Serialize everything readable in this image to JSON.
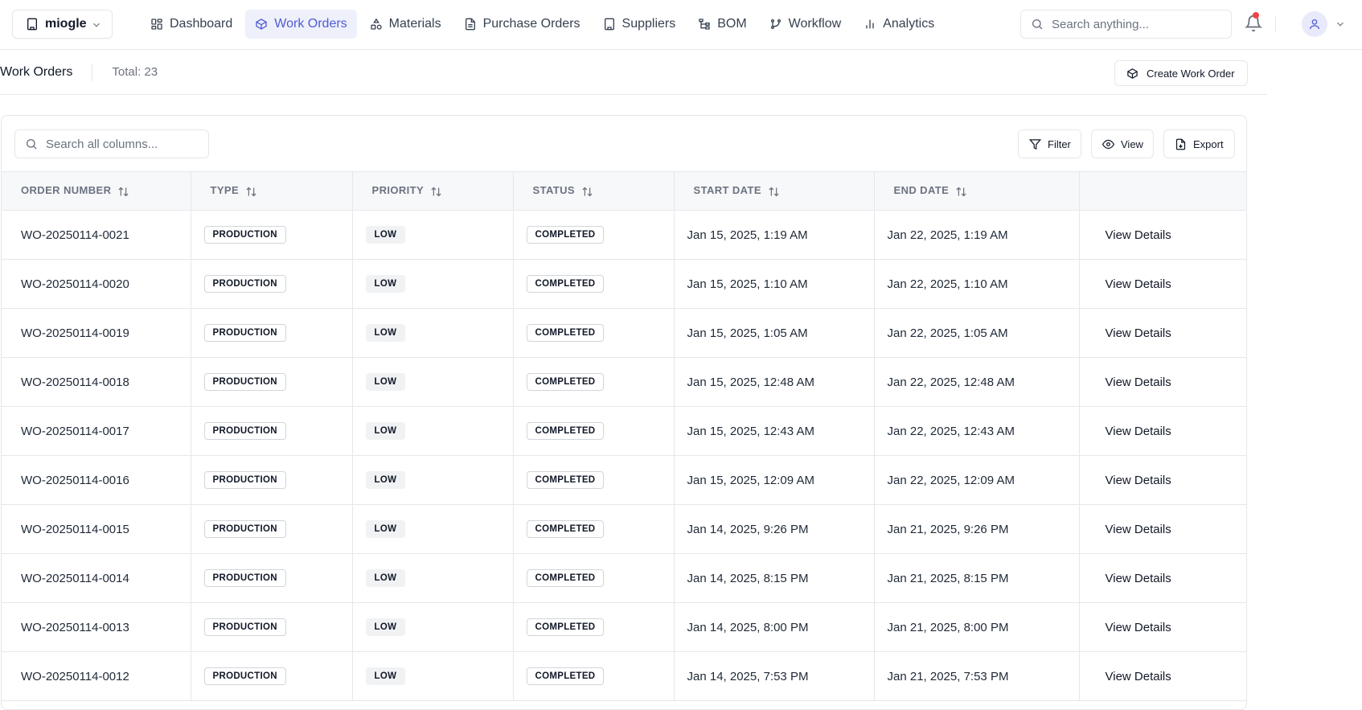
{
  "org": {
    "name": "miogle"
  },
  "nav": [
    {
      "label": "Dashboard",
      "icon": "dashboard-icon",
      "active": false
    },
    {
      "label": "Work Orders",
      "icon": "box-icon",
      "active": true
    },
    {
      "label": "Materials",
      "icon": "shapes-icon",
      "active": false
    },
    {
      "label": "Purchase Orders",
      "icon": "document-icon",
      "active": false
    },
    {
      "label": "Suppliers",
      "icon": "building-icon",
      "active": false
    },
    {
      "label": "BOM",
      "icon": "tree-icon",
      "active": false
    },
    {
      "label": "Workflow",
      "icon": "branch-icon",
      "active": false
    },
    {
      "label": "Analytics",
      "icon": "bar-chart-icon",
      "active": false
    }
  ],
  "search": {
    "placeholder": "Search anything..."
  },
  "subheader": {
    "title": "Work Orders",
    "total": "Total: 23",
    "create_label": "Create Work Order"
  },
  "table_toolbar": {
    "search_placeholder": "Search all columns...",
    "filter_label": "Filter",
    "view_label": "View",
    "export_label": "Export"
  },
  "table": {
    "columns": [
      "ORDER NUMBER",
      "TYPE",
      "PRIORITY",
      "STATUS",
      "START DATE",
      "END DATE",
      ""
    ],
    "rows": [
      {
        "order": "WO-20250114-0021",
        "type": "PRODUCTION",
        "priority": "LOW",
        "status": "COMPLETED",
        "start": "Jan 15, 2025, 1:19 AM",
        "end": "Jan 22, 2025, 1:19 AM",
        "action": "View Details"
      },
      {
        "order": "WO-20250114-0020",
        "type": "PRODUCTION",
        "priority": "LOW",
        "status": "COMPLETED",
        "start": "Jan 15, 2025, 1:10 AM",
        "end": "Jan 22, 2025, 1:10 AM",
        "action": "View Details"
      },
      {
        "order": "WO-20250114-0019",
        "type": "PRODUCTION",
        "priority": "LOW",
        "status": "COMPLETED",
        "start": "Jan 15, 2025, 1:05 AM",
        "end": "Jan 22, 2025, 1:05 AM",
        "action": "View Details"
      },
      {
        "order": "WO-20250114-0018",
        "type": "PRODUCTION",
        "priority": "LOW",
        "status": "COMPLETED",
        "start": "Jan 15, 2025, 12:48 AM",
        "end": "Jan 22, 2025, 12:48 AM",
        "action": "View Details"
      },
      {
        "order": "WO-20250114-0017",
        "type": "PRODUCTION",
        "priority": "LOW",
        "status": "COMPLETED",
        "start": "Jan 15, 2025, 12:43 AM",
        "end": "Jan 22, 2025, 12:43 AM",
        "action": "View Details"
      },
      {
        "order": "WO-20250114-0016",
        "type": "PRODUCTION",
        "priority": "LOW",
        "status": "COMPLETED",
        "start": "Jan 15, 2025, 12:09 AM",
        "end": "Jan 22, 2025, 12:09 AM",
        "action": "View Details"
      },
      {
        "order": "WO-20250114-0015",
        "type": "PRODUCTION",
        "priority": "LOW",
        "status": "COMPLETED",
        "start": "Jan 14, 2025, 9:26 PM",
        "end": "Jan 21, 2025, 9:26 PM",
        "action": "View Details"
      },
      {
        "order": "WO-20250114-0014",
        "type": "PRODUCTION",
        "priority": "LOW",
        "status": "COMPLETED",
        "start": "Jan 14, 2025, 8:15 PM",
        "end": "Jan 21, 2025, 8:15 PM",
        "action": "View Details"
      },
      {
        "order": "WO-20250114-0013",
        "type": "PRODUCTION",
        "priority": "LOW",
        "status": "COMPLETED",
        "start": "Jan 14, 2025, 8:00 PM",
        "end": "Jan 21, 2025, 8:00 PM",
        "action": "View Details"
      },
      {
        "order": "WO-20250114-0012",
        "type": "PRODUCTION",
        "priority": "LOW",
        "status": "COMPLETED",
        "start": "Jan 14, 2025, 7:53 PM",
        "end": "Jan 21, 2025, 7:53 PM",
        "action": "View Details"
      }
    ]
  },
  "colors": {
    "accent": "#4f5bd5",
    "accent_bg": "#eef0fb",
    "notification": "#ef4444",
    "border": "#e5e7eb"
  }
}
